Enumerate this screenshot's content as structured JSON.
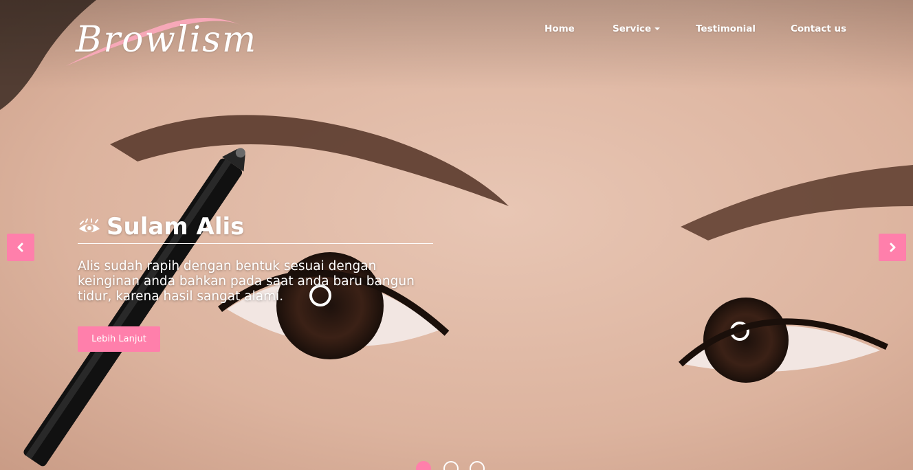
{
  "brand": {
    "name": "Browlism",
    "accent_color": "#f7a8b8"
  },
  "nav": {
    "items": [
      {
        "label": "Home"
      },
      {
        "label": "Service",
        "has_dropdown": true
      },
      {
        "label": "Testimonial"
      },
      {
        "label": "Contact us"
      }
    ]
  },
  "carousel": {
    "active_slide": 1,
    "slide_count": 3,
    "slide": {
      "icon": "eye-icon",
      "title": "Sulam Alis",
      "description": "Alis sudah rapih dengan bentuk sesuai dengan keinginan anda bahkan pada saat anda baru bangun tidur, karena hasil sangat alami.",
      "button_label": "Lebih Lanjut"
    },
    "prev_icon": "chevron-left-icon",
    "next_icon": "chevron-right-icon"
  },
  "colors": {
    "accent": "#ff7fab",
    "text": "#ffffff"
  }
}
